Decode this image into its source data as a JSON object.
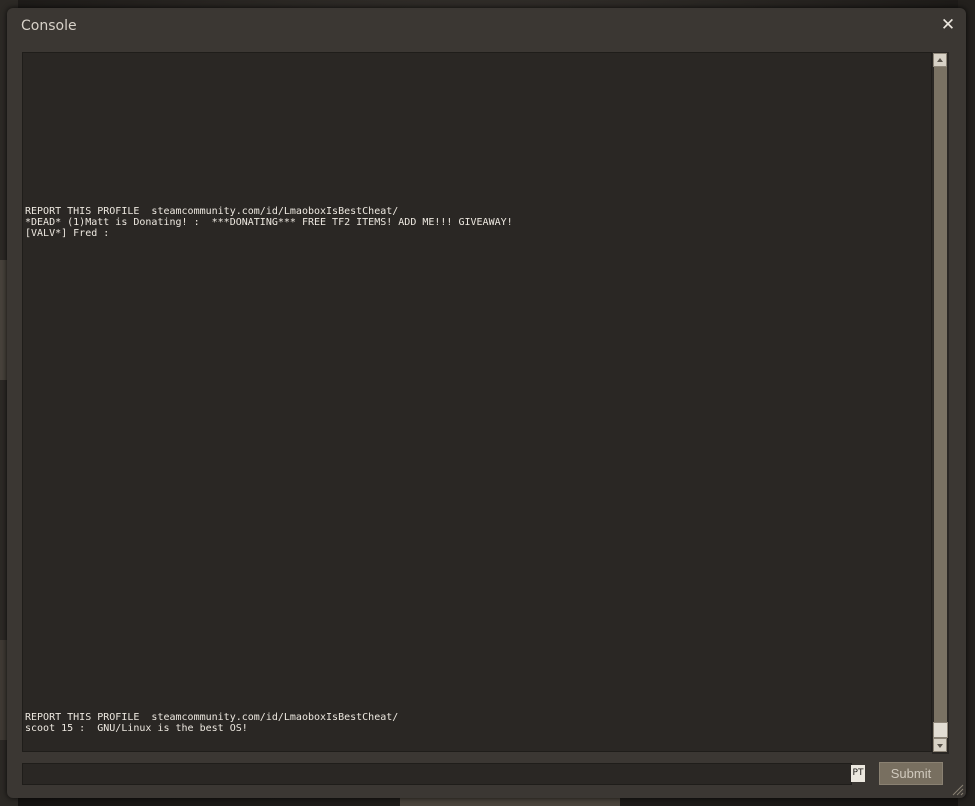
{
  "window": {
    "title": "Console",
    "close_icon": "close-icon",
    "close_glyph": "✕"
  },
  "console": {
    "lines": [
      "REPORT THIS PROFILE  steamcommunity.com/id/LmaoboxIsBestCheat/",
      "*DEAD* (1)Matt is Donating! :  ***DONATING*** FREE TF2 ITEMS! ADD ME!!! GIVEAWAY!",
      "[VALV*] Fred :",
      "REPORT THIS PROFILE  steamcommunity.com/id/LmaoboxIsBestCheat/",
      "scoot 15 :  GNU/Linux is the best OS!"
    ]
  },
  "scrollbar": {
    "up_icon": "chevron-up-icon",
    "down_icon": "chevron-down-icon",
    "position": 1.0
  },
  "input": {
    "value": "",
    "placeholder": "",
    "language_indicator": "PT"
  },
  "submit": {
    "label": "Submit"
  },
  "colors": {
    "window_bg": "#3b3733",
    "panel_bg": "#2a2724",
    "text": "#ede8e0",
    "scroll_track": "#7a7263",
    "submit_bg": "#786f60"
  }
}
